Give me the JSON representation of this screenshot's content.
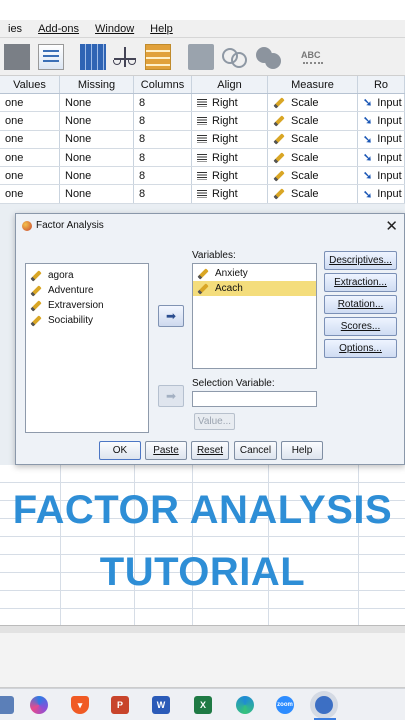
{
  "menubar": {
    "items": [
      "ies",
      "Add-ons",
      "Window",
      "Help"
    ]
  },
  "grid": {
    "headers": [
      "Values",
      "Missing",
      "Columns",
      "Align",
      "Measure",
      "Ro"
    ],
    "rows": [
      [
        "one",
        "None",
        "8",
        "Right",
        "Scale",
        "Input"
      ],
      [
        "one",
        "None",
        "8",
        "Right",
        "Scale",
        "Input"
      ],
      [
        "one",
        "None",
        "8",
        "Right",
        "Scale",
        "Input"
      ],
      [
        "one",
        "None",
        "8",
        "Right",
        "Scale",
        "Input"
      ],
      [
        "one",
        "None",
        "8",
        "Right",
        "Scale",
        "Input"
      ],
      [
        "one",
        "None",
        "8",
        "Right",
        "Scale",
        "Input"
      ]
    ]
  },
  "dialog": {
    "title": "Factor Analysis",
    "source_vars": [
      "agora",
      "Adventure",
      "Extraversion",
      "Sociability"
    ],
    "variables_label": "Variables:",
    "selected_vars": [
      "Anxiety",
      "Acach"
    ],
    "selected_highlight": "Acach",
    "selection_variable_label": "Selection Variable:",
    "value_button": "Value...",
    "side_buttons": [
      "Descriptives...",
      "Extraction...",
      "Rotation...",
      "Scores...",
      "Options..."
    ],
    "bottom_buttons": [
      "OK",
      "Paste",
      "Reset",
      "Cancel",
      "Help"
    ]
  },
  "overlay": {
    "line1": "FACTOR ANALYSIS",
    "line2": "TUTORIAL"
  },
  "taskbar": {
    "icons": [
      "settings-app-icon",
      "copilot-icon",
      "brave-icon",
      "powerpoint-icon",
      "word-icon",
      "excel-icon",
      "edge-icon",
      "zoom-icon",
      "browser-icon"
    ]
  },
  "colors": {
    "accent_text": "#2e8ed6",
    "selection": "#f4dd7c"
  }
}
